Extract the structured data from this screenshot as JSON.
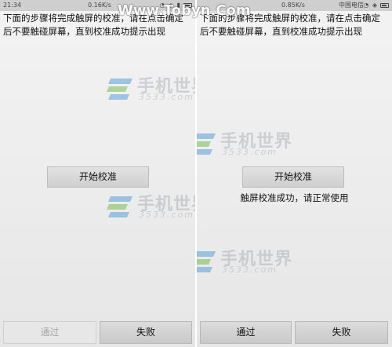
{
  "left": {
    "status": {
      "time": "21:34",
      "speed": "0.16K/s"
    },
    "instruction": "下面的步骤将完成触屏的校准，请在点击确定后不要触碰屏幕，直到校准成功提示出现",
    "start_button": "开始校准",
    "pass_button": "通过",
    "fail_button": "失败"
  },
  "right": {
    "status": {
      "speed": "0.85K/s",
      "carrier": "中国电信"
    },
    "instruction": "下面的步骤将完成触屏的校准，请在点击确定后不要触碰屏幕，直到校准成功提示出现",
    "start_button": "开始校准",
    "success_text": "触屏校准成功，请正常使用",
    "pass_button": "通过",
    "fail_button": "失败"
  },
  "watermark": {
    "site": "Www.Tobyn.Com",
    "cn": "手机世界",
    "num": "3533.com"
  },
  "colors": {
    "logo_blue": "#3b8fd6",
    "logo_green": "#5fb336",
    "button_gray": "#d6d6d6"
  }
}
